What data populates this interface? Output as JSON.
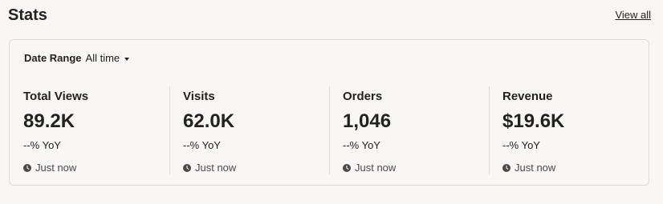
{
  "header": {
    "title": "Stats",
    "view_all_label": "View all"
  },
  "filter": {
    "label": "Date Range",
    "value": "All time",
    "icon": "caret-down-icon"
  },
  "stats": [
    {
      "label": "Total Views",
      "value": "89.2K",
      "yoy": "--% YoY",
      "updated": "Just now"
    },
    {
      "label": "Visits",
      "value": "62.0K",
      "yoy": "--% YoY",
      "updated": "Just now"
    },
    {
      "label": "Orders",
      "value": "1,046",
      "yoy": "--% YoY",
      "updated": "Just now"
    },
    {
      "label": "Revenue",
      "value": "$19.6K",
      "yoy": "--% YoY",
      "updated": "Just now"
    }
  ],
  "icons": {
    "updated": "clock-icon"
  },
  "colors": {
    "background": "#f8f7f4",
    "text": "#222222",
    "border": "#dcdad5"
  }
}
